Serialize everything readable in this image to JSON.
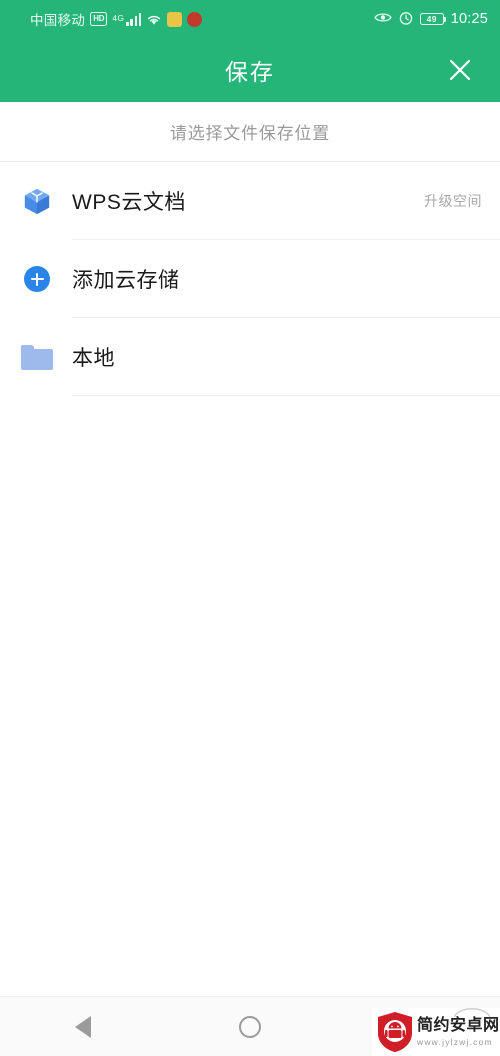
{
  "status_bar": {
    "carrier": "中国移动",
    "hd_badge": "HD",
    "network": "4G",
    "signal_icon": "signal-bars-icon",
    "wifi_icon": "wifi-icon",
    "app_icon_1": "app-badge-yellow-icon",
    "app_icon_2": "app-badge-red-icon",
    "eye_icon": "eye-icon",
    "alarm_icon": "alarm-clock-icon",
    "battery_level": "49",
    "time": "10:25"
  },
  "app_bar": {
    "title": "保存",
    "close_icon": "close-icon"
  },
  "subtitle": "请选择文件保存位置",
  "list": {
    "items": [
      {
        "icon": "cube-icon",
        "label": "WPS云文档",
        "action": "升级空间"
      },
      {
        "icon": "plus-circle-icon",
        "label": "添加云存储",
        "action": ""
      },
      {
        "icon": "folder-icon",
        "label": "本地",
        "action": ""
      }
    ]
  },
  "nav_bar": {
    "back_icon": "back-triangle-icon",
    "home_icon": "home-circle-icon",
    "recents_icon": "recents-square-icon"
  },
  "watermark": {
    "title": "简约安卓网",
    "url": "www.jylzwj.com",
    "logo_icon": "shield-android-logo-icon"
  },
  "colors": {
    "brand_green": "#25B579",
    "accent_blue": "#2B85E8",
    "folder_blue": "#9EB9EC",
    "watermark_red": "#D01E28",
    "text_primary": "#1a1a1a",
    "text_muted": "#9a9a9a"
  }
}
